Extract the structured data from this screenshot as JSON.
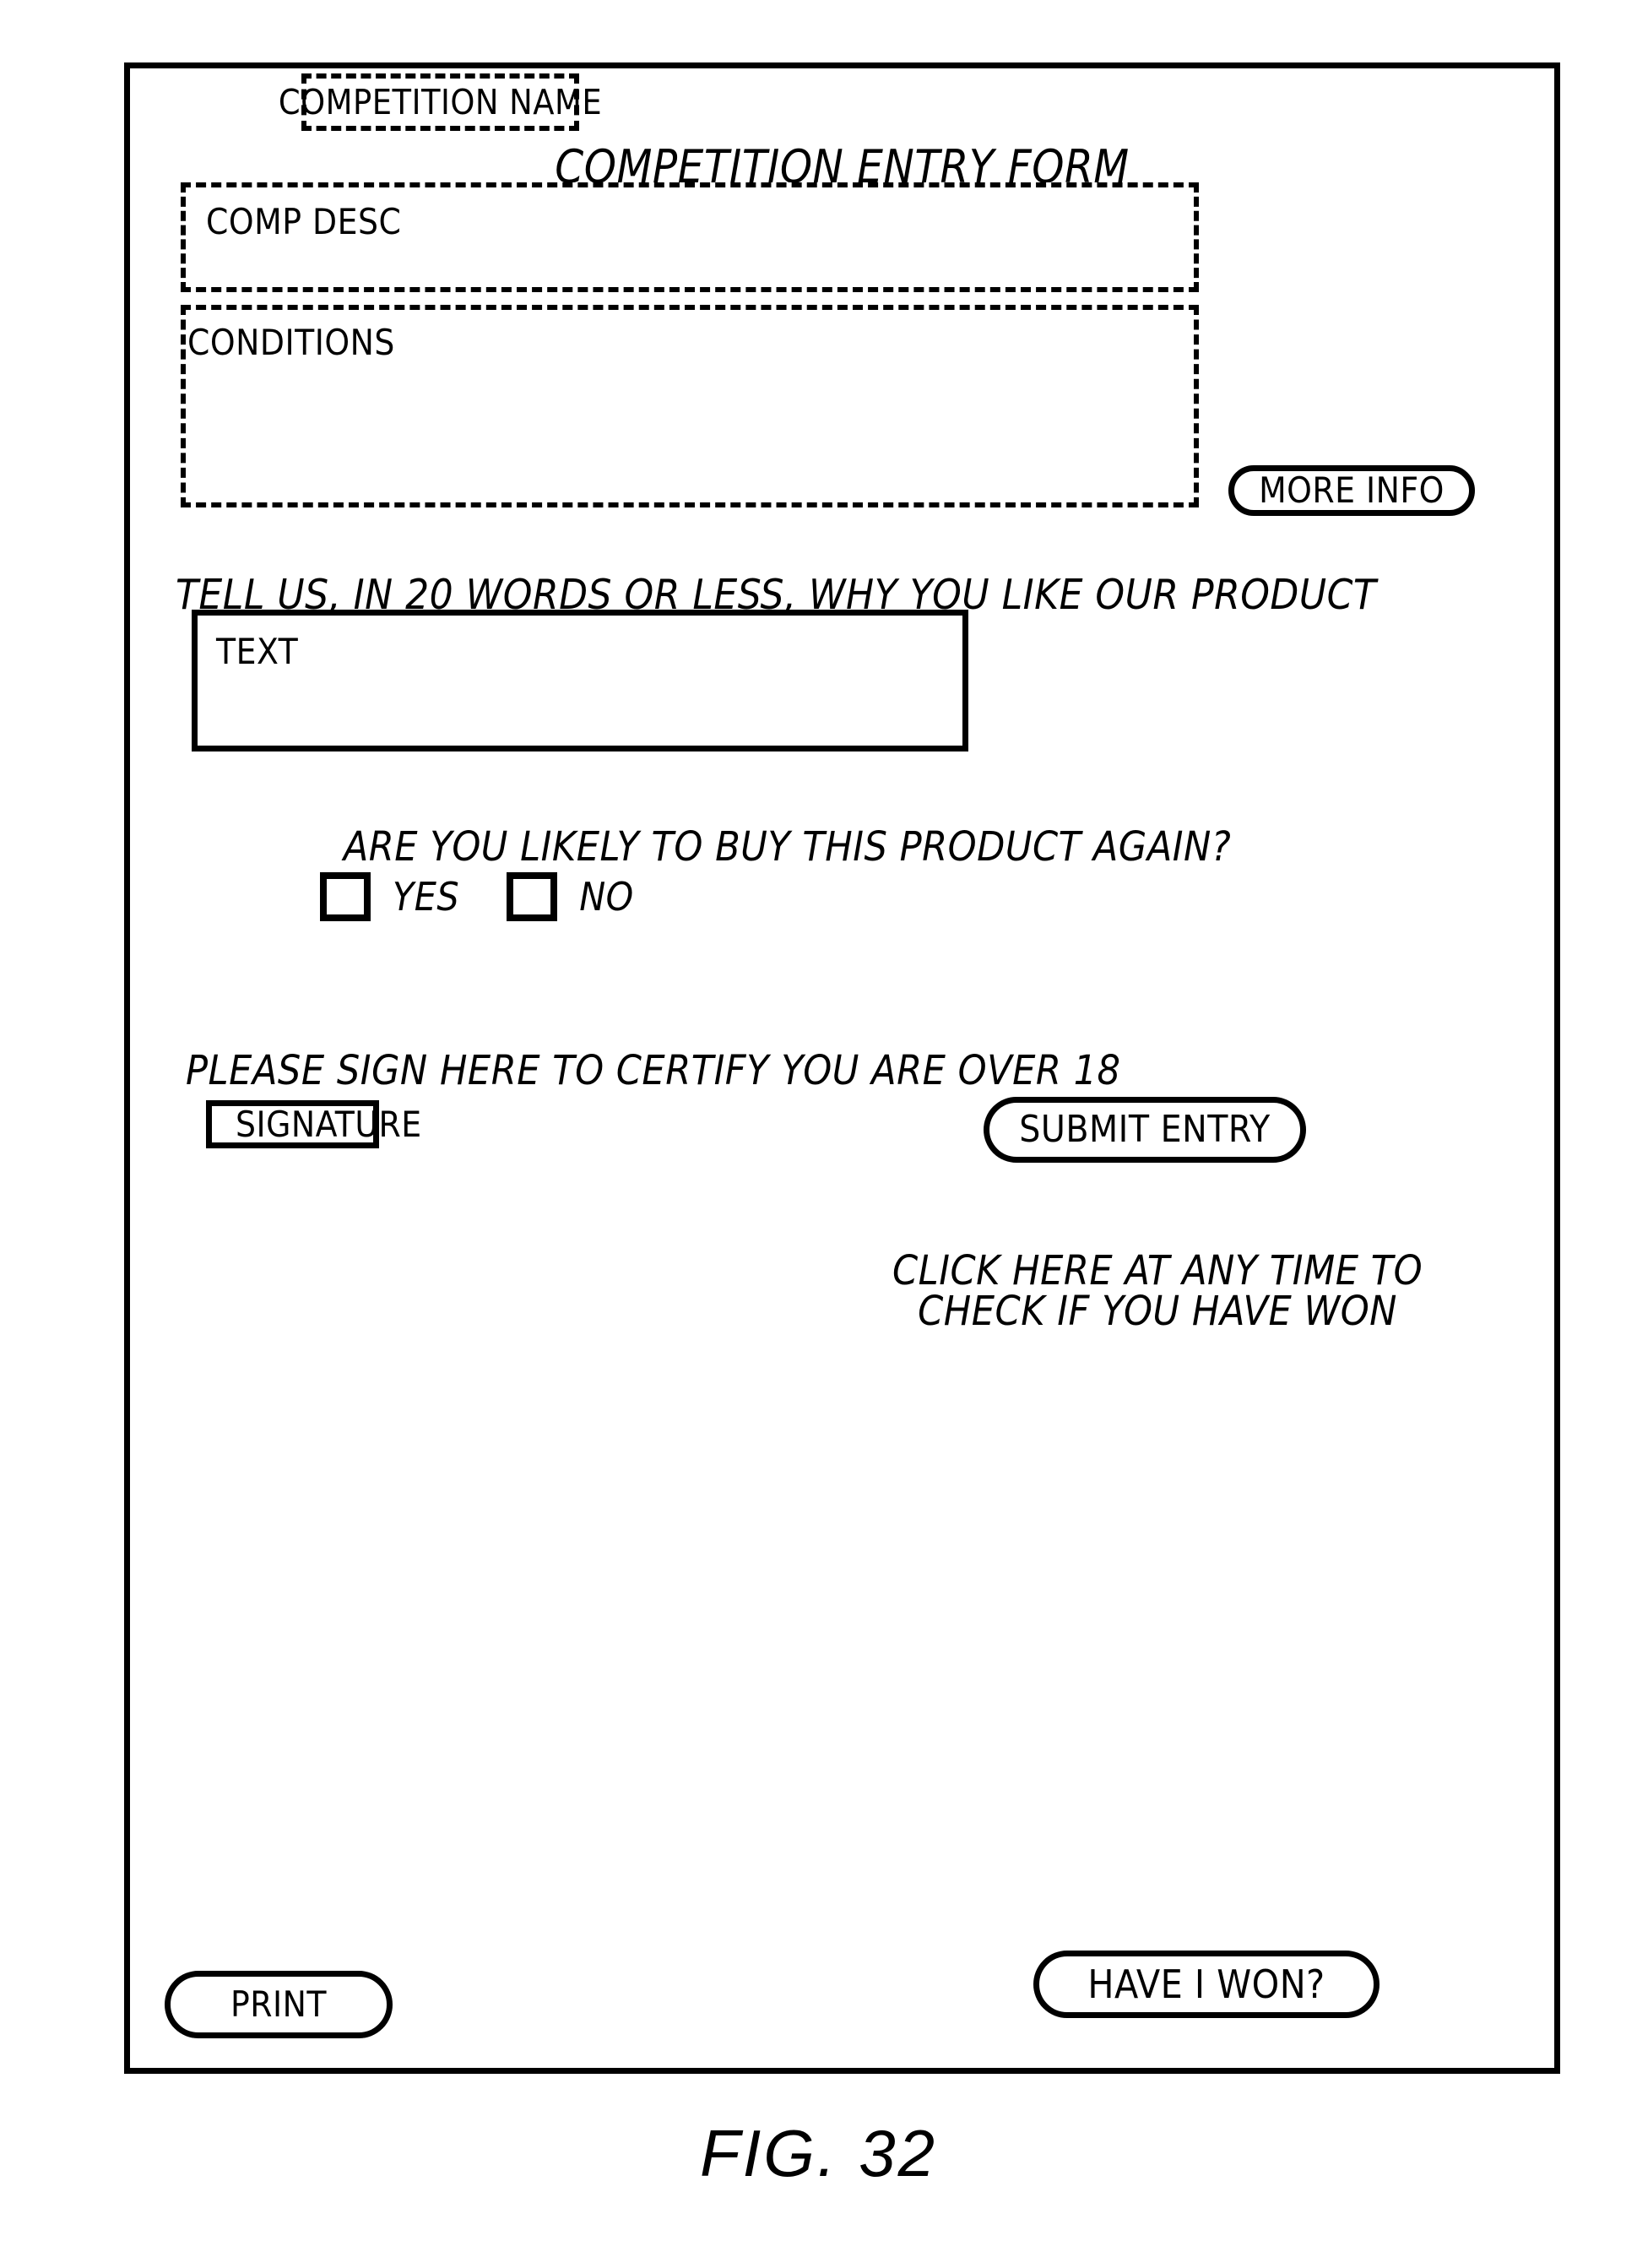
{
  "figure": {
    "caption": "FIG. 32"
  },
  "form": {
    "competition_name_field": "COMPETITION NAME",
    "title": "COMPETITION ENTRY FORM",
    "comp_description_field": "COMP DESC",
    "conditions_field": "CONDITIONS",
    "more_info_label": "MORE INFO",
    "tell_us_prompt": "TELL US, IN 20 WORDS OR LESS, WHY YOU LIKE OUR PRODUCT",
    "text_entry_field": "TEXT",
    "buy_again_question": "ARE YOU LIKELY TO BUY THIS PRODUCT AGAIN?",
    "options": [
      {
        "label": "YES",
        "checked": false
      },
      {
        "label": "NO",
        "checked": false
      }
    ],
    "sign_instruction": "PLEASE SIGN HERE TO CERTIFY YOU ARE OVER 18",
    "signature_field": "SIGNATURE",
    "submit_label": "SUBMIT ENTRY",
    "check_hint_line1": "CLICK HERE AT ANY TIME TO",
    "check_hint_line2": "CHECK IF YOU HAVE WON",
    "print_label": "PRINT",
    "have_i_won_label": "HAVE I WON?"
  },
  "colors": {
    "ink": "#000000",
    "paper": "#ffffff"
  }
}
